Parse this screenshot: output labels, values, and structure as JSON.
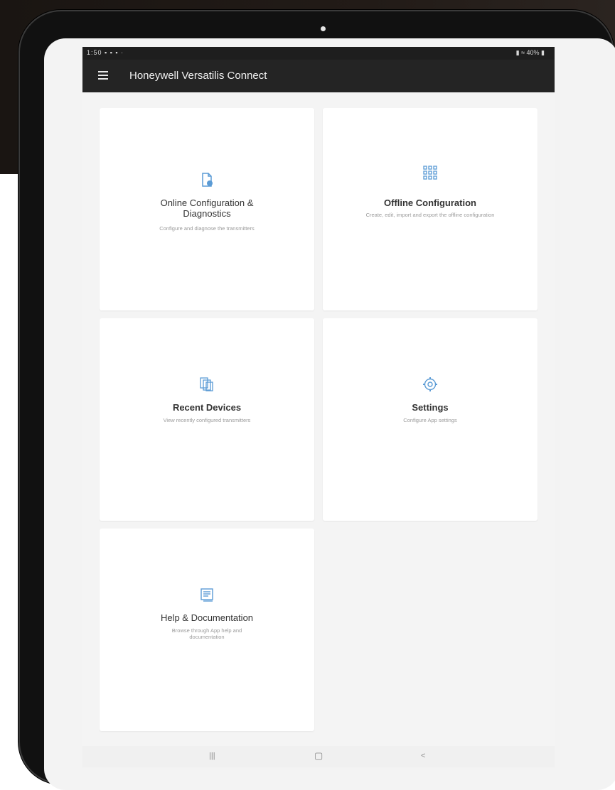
{
  "status_bar": {
    "time_and_notifications": "1:50 ▪ ▪ ▪ ·",
    "battery": "40%"
  },
  "app": {
    "title": "Honeywell Versatilis Connect"
  },
  "tiles": [
    {
      "title": "Online Configuration & Diagnostics",
      "description": "Configure and diagnose the transmitters",
      "icon": "document-config-icon"
    },
    {
      "title": "Offline Configuration",
      "description": "Create, edit, import and export the offline configuration",
      "icon": "grid-icon"
    },
    {
      "title": "Recent Devices",
      "description": "View recently configured transmitters",
      "icon": "devices-icon"
    },
    {
      "title": "Settings",
      "description": "Configure App settings",
      "icon": "gear-icon"
    },
    {
      "title": "Help & Documentation",
      "description": "Browse through App help and documentation",
      "icon": "help-doc-icon"
    }
  ],
  "nav": {
    "recent": "|||",
    "home": "▢",
    "back": "<"
  },
  "colors": {
    "accent": "#5b9bd5",
    "app_bar": "#242424",
    "status_bar": "#1e1e1e"
  }
}
